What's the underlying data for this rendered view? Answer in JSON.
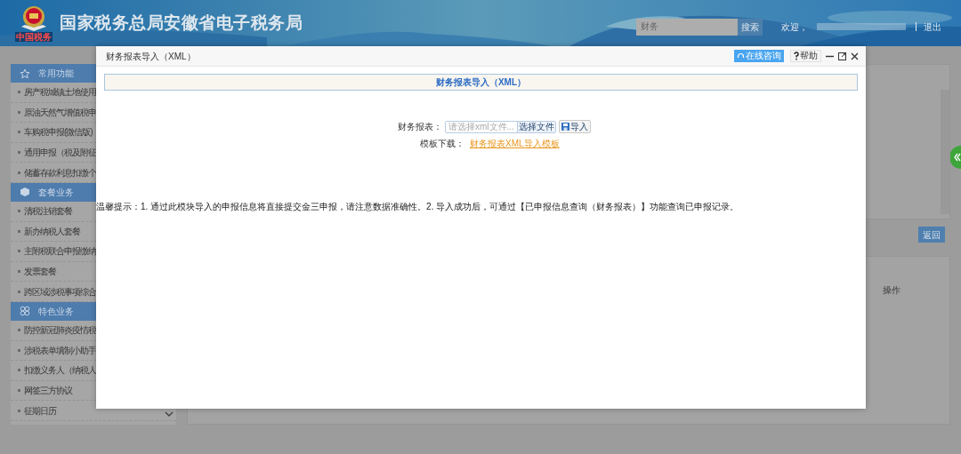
{
  "header": {
    "logo_text": "中国税务",
    "title": "国家税务总局安徽省电子税务局",
    "search": {
      "value": "财务",
      "button": "搜索"
    },
    "welcome": "欢迎，",
    "logout": "退出"
  },
  "sidebar": {
    "sections": [
      {
        "title": "常用功能",
        "items": [
          "房产税城镇土地使用",
          "原油天然气增值税申",
          "车购税申报(微信版)",
          "通用申报（税及附征",
          "储蓄存款利息扣缴个"
        ]
      },
      {
        "title": "套餐业务",
        "items": [
          "清税注销套餐",
          "新办纳税人套餐",
          "主附税联合申报缴纳",
          "发票套餐",
          "跨区域涉税事项综合"
        ]
      },
      {
        "title": "特色业务",
        "items": [
          "防控新冠肺炎疫情税",
          "涉税表单填制小助手",
          "扣缴义务人（纳税人",
          "网签三方协议",
          "征期日历"
        ]
      }
    ]
  },
  "background_panel": {
    "return_button": "返回",
    "column_header": "操作"
  },
  "dialog": {
    "title": "财务报表导入（XML）",
    "consult_button": "在线咨询",
    "help_button": "帮助",
    "heading": "财务报表导入（XML）",
    "file_label": "财务报表：",
    "file_placeholder": "请选择xml文件...",
    "choose_button": "选择文件",
    "import_button": "导入",
    "template_label": "模板下载：",
    "template_link": "财务报表XML导入模板",
    "tip": "温馨提示：1. 通过此模块导入的申报信息将直接提交金三申报，请注意数据准确性。2. 导入成功后，可通过【已申报信息查询（财务报表）】功能查询已申报记录。"
  }
}
